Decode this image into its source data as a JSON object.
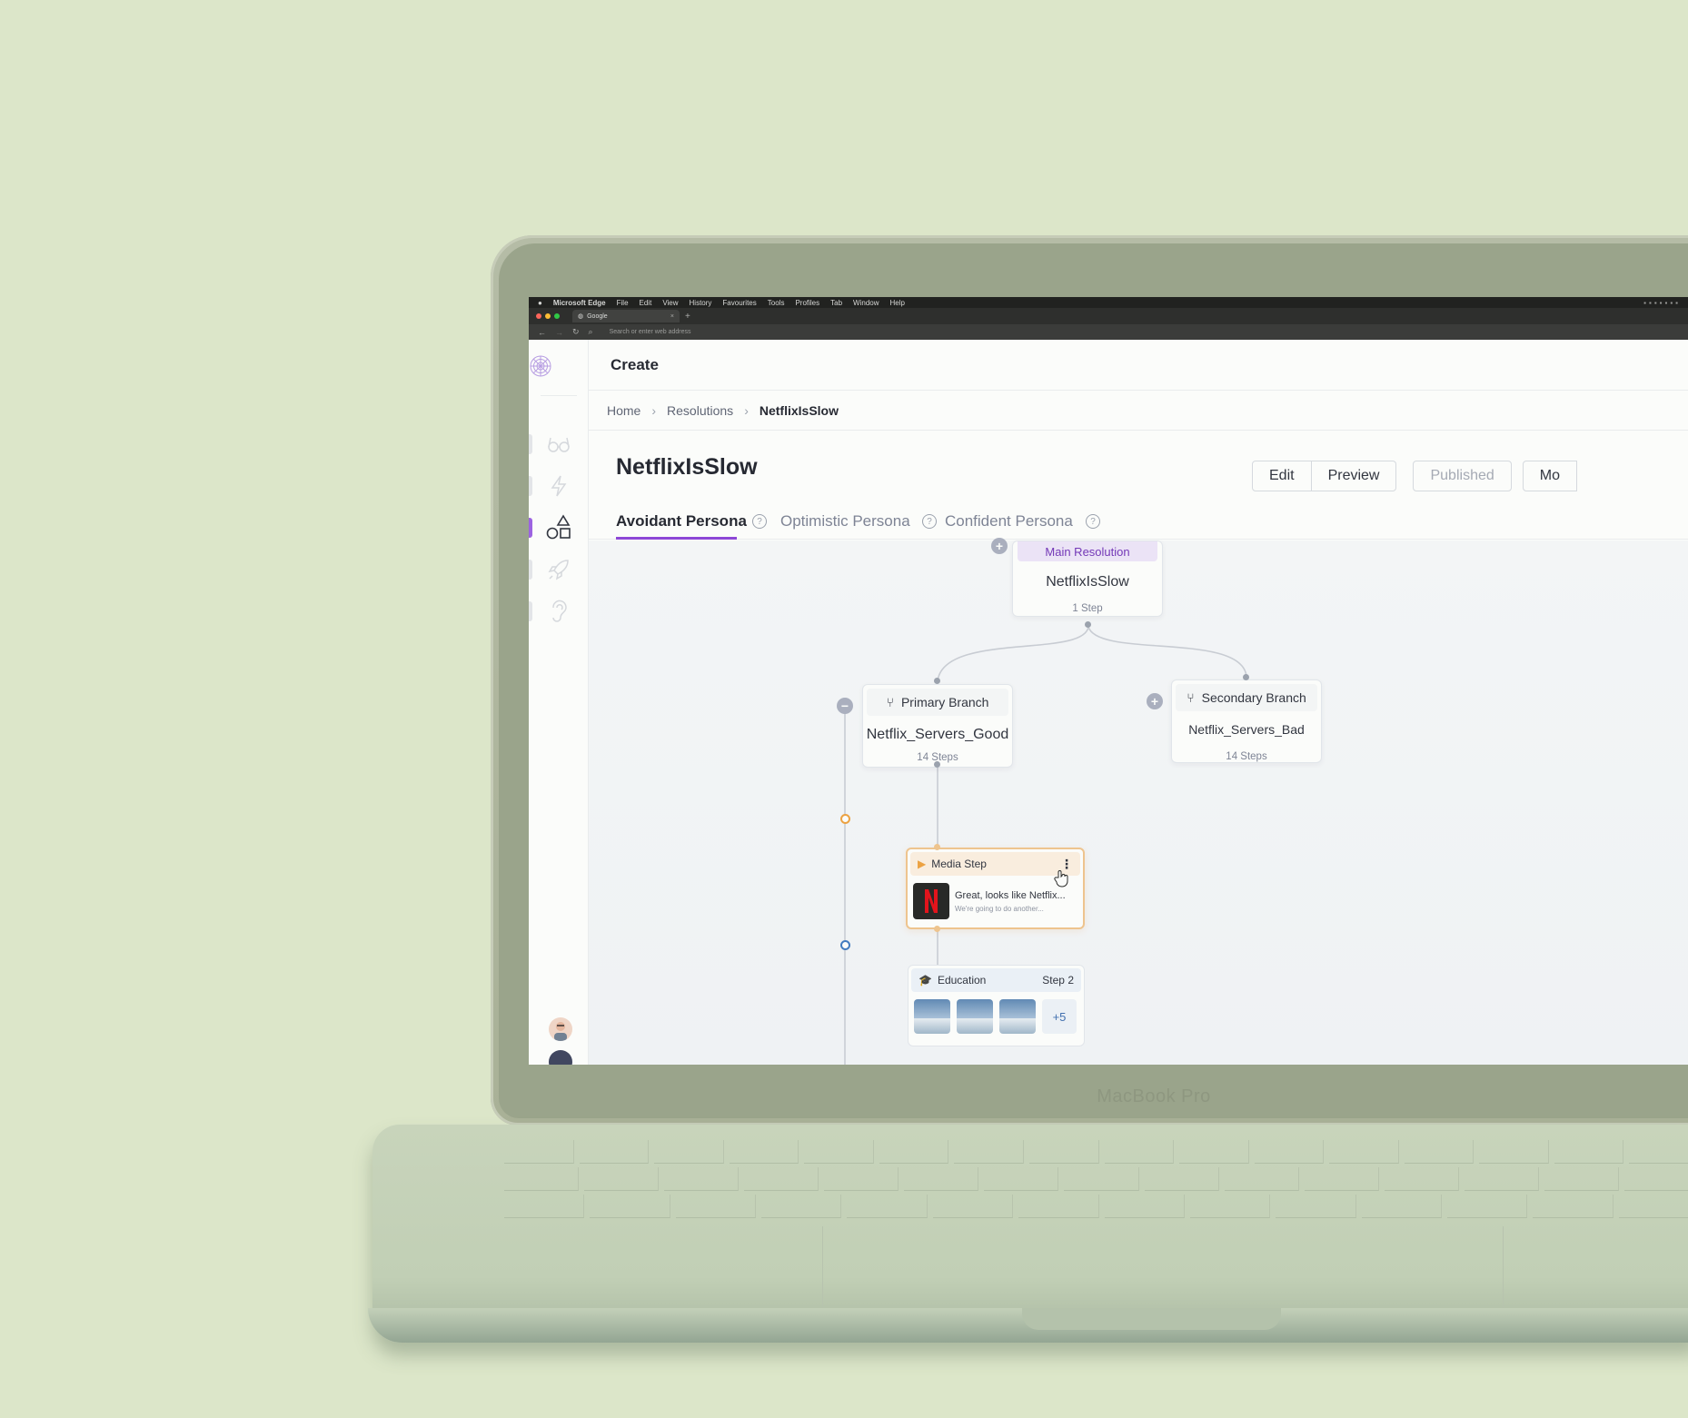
{
  "laptop": {
    "model_label": "MacBook Pro"
  },
  "mac_menubar": {
    "app": "Microsoft Edge",
    "items": [
      "File",
      "Edit",
      "View",
      "History",
      "Favourites",
      "Tools",
      "Profiles",
      "Tab",
      "Window",
      "Help"
    ]
  },
  "browser": {
    "tab_title": "Google",
    "address_placeholder": "Search or enter web address"
  },
  "app": {
    "header_title": "Create",
    "breadcrumb": {
      "home": "Home",
      "section": "Resolutions",
      "current": "NetflixIsSlow"
    },
    "page_title": "NetflixIsSlow",
    "actions": {
      "edit": "Edit",
      "preview": "Preview",
      "published": "Published",
      "more": "Mo"
    },
    "tabs": [
      {
        "label": "Avoidant Persona",
        "active": true
      },
      {
        "label": "Optimistic Persona",
        "active": false
      },
      {
        "label": "Confident Persona",
        "active": false
      }
    ],
    "help_glyph": "?"
  },
  "flow": {
    "main_resolution": {
      "chip": "Main Resolution",
      "name": "NetflixIsSlow",
      "steps": "1 Step"
    },
    "primary_branch": {
      "label": "Primary Branch",
      "name": "Netflix_Servers_Good",
      "steps": "14 Steps"
    },
    "secondary_branch": {
      "label": "Secondary Branch",
      "name": "Netflix_Servers_Bad",
      "steps": "14 Steps"
    },
    "media_step": {
      "label": "Media Step",
      "text": "Great, looks like Netflix...",
      "subtext": "We're going to do another..."
    },
    "education_step": {
      "label": "Education",
      "step": "Step 2",
      "more_count": "+5"
    },
    "collapse_glyph": "−",
    "expand_glyph": "+"
  },
  "colors": {
    "accent_purple": "#8b3fd9",
    "media_orange": "#f2c48d",
    "background_green": "#dce6c9"
  }
}
